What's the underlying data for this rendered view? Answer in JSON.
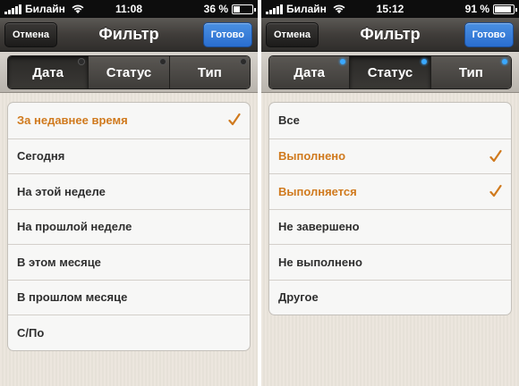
{
  "screens": [
    {
      "status": {
        "carrier": "Билайн",
        "time": "11:08",
        "battery": "36 %",
        "battery_level": 0.36
      },
      "nav": {
        "cancel": "Отмена",
        "title": "Фильтр",
        "done": "Готово"
      },
      "segments": [
        {
          "label": "Дата",
          "active": true,
          "indicator": false
        },
        {
          "label": "Статус",
          "active": false,
          "indicator": false
        },
        {
          "label": "Тип",
          "active": false,
          "indicator": false
        }
      ],
      "items": [
        {
          "label": "За недавнее время",
          "selected": true
        },
        {
          "label": "Сегодня",
          "selected": false
        },
        {
          "label": "На этой неделе",
          "selected": false
        },
        {
          "label": "На прошлой неделе",
          "selected": false
        },
        {
          "label": "В этом месяце",
          "selected": false
        },
        {
          "label": "В прошлом месяце",
          "selected": false
        },
        {
          "label": "С/По",
          "selected": false
        }
      ]
    },
    {
      "status": {
        "carrier": "Билайн",
        "time": "15:12",
        "battery": "91 %",
        "battery_level": 0.91
      },
      "nav": {
        "cancel": "Отмена",
        "title": "Фильтр",
        "done": "Готово"
      },
      "segments": [
        {
          "label": "Дата",
          "active": false,
          "indicator": true
        },
        {
          "label": "Статус",
          "active": true,
          "indicator": true
        },
        {
          "label": "Тип",
          "active": false,
          "indicator": true
        }
      ],
      "items": [
        {
          "label": "Все",
          "selected": false
        },
        {
          "label": "Выполнено",
          "selected": true
        },
        {
          "label": "Выполняется",
          "selected": true
        },
        {
          "label": "Не завершено",
          "selected": false
        },
        {
          "label": "Не выполнено",
          "selected": false
        },
        {
          "label": "Другое",
          "selected": false
        }
      ]
    }
  ],
  "colors": {
    "accent_selected": "#d07a1e",
    "done_button": "#2a6ed0",
    "indicator_on": "#3aa8ff"
  },
  "icons": [
    "signal-icon",
    "wifi-icon",
    "battery-icon",
    "checkmark-icon"
  ]
}
